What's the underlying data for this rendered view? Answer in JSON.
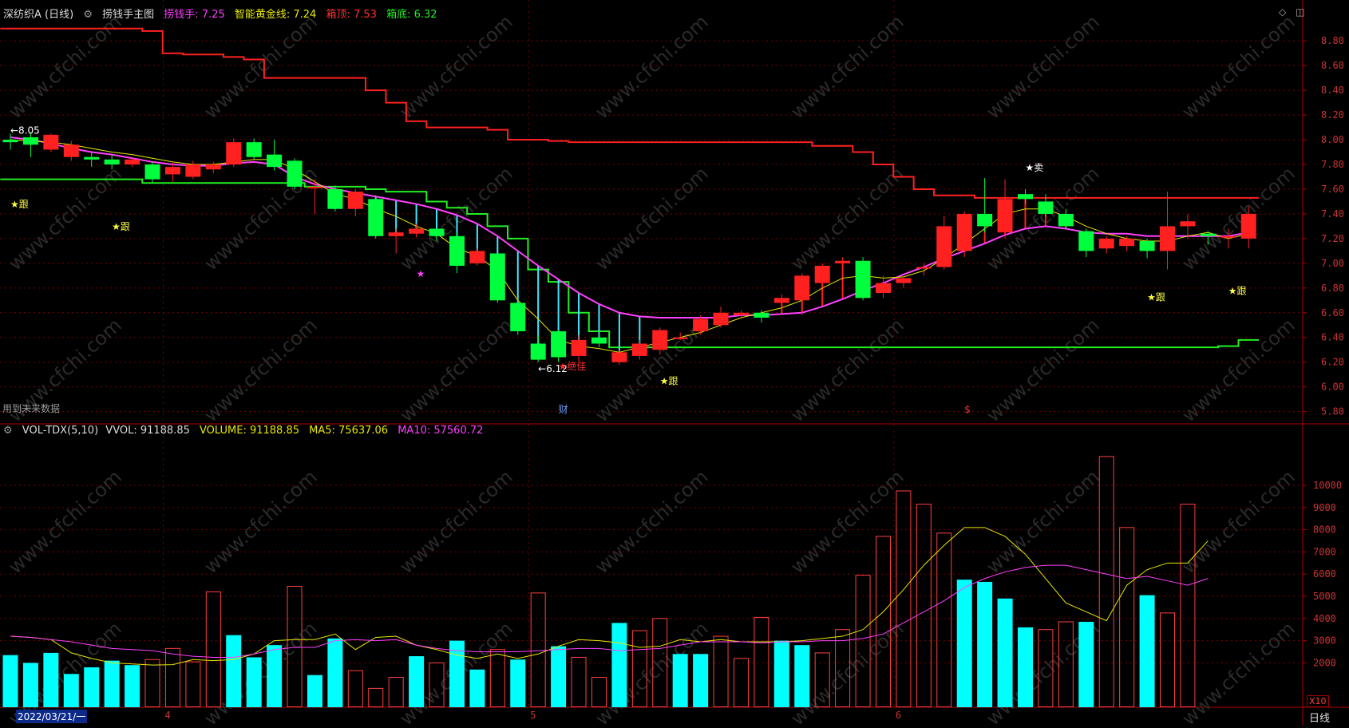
{
  "main_header": {
    "stock": "深纺织A (日线)",
    "indicator": "捞钱手主图",
    "lqs_label": "捞钱手: 7.25",
    "gold_label": "智能黄金线: 7.24",
    "top_label": "箱顶: 7.53",
    "bottom_label": "箱底: 6.32"
  },
  "vol_header": {
    "name": "VOL-TDX(5,10)",
    "vvol": "VVOL: 91188.85",
    "volume": "VOLUME: 91188.85",
    "ma5": "MA5: 75637.06",
    "ma10": "MA10: 57560.72"
  },
  "future_note": "用到未来数据",
  "date_label": "2022/03/21/一",
  "period_label": "日线",
  "vol_unit": "X10",
  "watermark": "www.cfchi.com",
  "colors": {
    "up": "#ff2020",
    "down": "#00ff3c",
    "vol_down": "#00ffff",
    "ma5": "#e8e800",
    "ma10": "#ff40ff",
    "box_top": "#ff2020",
    "box_bottom": "#22ee22",
    "grid": "#7a0000"
  },
  "chart_data": [
    {
      "type": "candlestick",
      "y_ticks": [
        "8.80",
        "8.60",
        "8.40",
        "8.20",
        "8.00",
        "7.80",
        "7.60",
        "7.40",
        "7.20",
        "7.00",
        "6.80",
        "6.60",
        "6.40",
        "6.20",
        "6.00",
        "5.80"
      ],
      "ylim": [
        5.72,
        8.95
      ],
      "month_markers": [
        "4",
        "5",
        "6"
      ],
      "candles": [
        [
          8.0,
          7.98,
          8.05,
          7.92
        ],
        [
          8.02,
          7.96,
          8.06,
          7.86
        ],
        [
          7.92,
          8.04,
          8.05,
          7.9
        ],
        [
          7.86,
          7.96,
          7.99,
          7.83
        ],
        [
          7.86,
          7.84,
          7.9,
          7.78
        ],
        [
          7.84,
          7.8,
          7.88,
          7.76
        ],
        [
          7.8,
          7.84,
          7.86,
          7.78
        ],
        [
          7.8,
          7.68,
          7.82,
          7.65
        ],
        [
          7.72,
          7.78,
          7.82,
          7.66
        ],
        [
          7.7,
          7.8,
          7.83,
          7.68
        ],
        [
          7.76,
          7.8,
          7.82,
          7.73
        ],
        [
          7.8,
          7.98,
          8.01,
          7.78
        ],
        [
          7.98,
          7.86,
          8.01,
          7.84
        ],
        [
          7.88,
          7.78,
          8.0,
          7.75
        ],
        [
          7.83,
          7.62,
          7.85,
          7.6
        ],
        [
          7.62,
          7.62,
          7.68,
          7.4
        ],
        [
          7.6,
          7.44,
          7.63,
          7.42
        ],
        [
          7.44,
          7.58,
          7.6,
          7.38
        ],
        [
          7.52,
          7.22,
          7.55,
          7.2
        ],
        [
          7.22,
          7.25,
          7.28,
          7.08
        ],
        [
          7.24,
          7.28,
          7.32,
          7.21
        ],
        [
          7.28,
          7.22,
          7.28,
          7.18
        ],
        [
          7.22,
          6.98,
          7.25,
          6.92
        ],
        [
          7.0,
          7.1,
          7.12,
          6.98
        ],
        [
          7.08,
          6.7,
          7.08,
          6.68
        ],
        [
          6.68,
          6.45,
          6.72,
          6.42
        ],
        [
          6.35,
          6.22,
          6.42,
          6.2
        ],
        [
          6.45,
          6.24,
          6.46,
          6.2
        ],
        [
          6.25,
          6.38,
          6.42,
          6.2
        ],
        [
          6.4,
          6.35,
          6.45,
          6.32
        ],
        [
          6.2,
          6.28,
          6.3,
          6.18
        ],
        [
          6.25,
          6.35,
          6.38,
          6.22
        ],
        [
          6.3,
          6.46,
          6.48,
          6.26
        ],
        [
          6.4,
          6.4,
          6.44,
          6.38
        ],
        [
          6.45,
          6.55,
          6.58,
          6.42
        ],
        [
          6.5,
          6.6,
          6.65,
          6.48
        ],
        [
          6.58,
          6.6,
          6.62,
          6.55
        ],
        [
          6.6,
          6.56,
          6.62,
          6.52
        ],
        [
          6.68,
          6.72,
          6.75,
          6.62
        ],
        [
          6.7,
          6.9,
          6.92,
          6.58
        ],
        [
          6.84,
          6.98,
          7.0,
          6.8
        ],
        [
          7.0,
          7.02,
          7.05,
          6.9
        ],
        [
          7.02,
          6.72,
          7.05,
          6.7
        ],
        [
          6.76,
          6.84,
          6.9,
          6.72
        ],
        [
          6.84,
          6.88,
          6.9,
          6.8
        ],
        [
          6.96,
          6.97,
          7.0,
          6.9
        ],
        [
          6.97,
          7.3,
          7.38,
          6.95
        ],
        [
          7.1,
          7.4,
          7.42,
          7.05
        ],
        [
          7.4,
          7.3,
          7.69,
          7.25
        ],
        [
          7.25,
          7.52,
          7.68,
          7.2
        ],
        [
          7.56,
          7.52,
          7.6,
          7.48
        ],
        [
          7.5,
          7.4,
          7.56,
          7.38
        ],
        [
          7.4,
          7.3,
          7.44,
          7.28
        ],
        [
          7.26,
          7.1,
          7.28,
          7.05
        ],
        [
          7.12,
          7.2,
          7.22,
          7.08
        ],
        [
          7.14,
          7.2,
          7.22,
          7.1
        ],
        [
          7.18,
          7.1,
          7.2,
          7.04
        ],
        [
          7.1,
          7.3,
          7.58,
          6.95
        ],
        [
          7.3,
          7.34,
          7.4,
          7.2
        ],
        [
          7.24,
          7.22,
          7.26,
          7.15
        ],
        [
          7.22,
          7.22,
          7.28,
          7.12
        ],
        [
          7.2,
          7.4,
          7.46,
          7.12
        ]
      ],
      "series": [
        {
          "name": "箱顶",
          "values": [
            8.9,
            8.9,
            8.9,
            8.9,
            8.9,
            8.9,
            8.9,
            8.88,
            8.7,
            8.69,
            8.69,
            8.67,
            8.65,
            8.5,
            8.5,
            8.5,
            8.5,
            8.5,
            8.4,
            8.3,
            8.15,
            8.1,
            8.1,
            8.1,
            8.08,
            8.0,
            8.0,
            7.99,
            7.98,
            7.98,
            7.98,
            7.98,
            7.98,
            7.98,
            7.98,
            7.98,
            7.98,
            7.98,
            7.98,
            7.98,
            7.95,
            7.95,
            7.9,
            7.8,
            7.7,
            7.6,
            7.55,
            7.55,
            7.53,
            7.53,
            7.53,
            7.53,
            7.53,
            7.53,
            7.53,
            7.53,
            7.53,
            7.53,
            7.53,
            7.53,
            7.53,
            7.53
          ]
        },
        {
          "name": "箱底",
          "values": [
            7.68,
            7.68,
            7.68,
            7.68,
            7.68,
            7.68,
            7.68,
            7.65,
            7.65,
            7.65,
            7.65,
            7.65,
            7.65,
            7.65,
            7.65,
            7.62,
            7.62,
            7.62,
            7.6,
            7.58,
            7.58,
            7.5,
            7.45,
            7.4,
            7.3,
            7.2,
            6.95,
            6.85,
            6.6,
            6.45,
            6.32,
            6.32,
            6.32,
            6.32,
            6.32,
            6.32,
            6.32,
            6.32,
            6.32,
            6.32,
            6.32,
            6.32,
            6.32,
            6.32,
            6.32,
            6.32,
            6.32,
            6.32,
            6.32,
            6.32,
            6.32,
            6.32,
            6.32,
            6.32,
            6.32,
            6.32,
            6.32,
            6.32,
            6.32,
            6.32,
            6.33,
            6.38
          ]
        },
        {
          "name": "捞钱手",
          "values": [
            8.02,
            8.0,
            7.97,
            7.93,
            7.9,
            7.88,
            7.85,
            7.82,
            7.8,
            7.79,
            7.79,
            7.81,
            7.82,
            7.8,
            7.7,
            7.64,
            7.6,
            7.57,
            7.54,
            7.51,
            7.48,
            7.44,
            7.39,
            7.32,
            7.22,
            7.1,
            6.98,
            6.87,
            6.76,
            6.67,
            6.6,
            6.57,
            6.56,
            6.56,
            6.56,
            6.56,
            6.58,
            6.58,
            6.59,
            6.6,
            6.65,
            6.71,
            6.78,
            6.84,
            6.91,
            6.97,
            7.04,
            7.1,
            7.16,
            7.23,
            7.28,
            7.3,
            7.28,
            7.25,
            7.24,
            7.24,
            7.22,
            7.22,
            7.22,
            7.22,
            7.22,
            7.25
          ]
        },
        {
          "name": "智能黄金线",
          "values": [
            8.0,
            7.99,
            7.98,
            7.96,
            7.93,
            7.9,
            7.88,
            7.85,
            7.82,
            7.8,
            7.8,
            7.82,
            7.84,
            7.84,
            7.76,
            7.66,
            7.56,
            7.52,
            7.44,
            7.38,
            7.3,
            7.24,
            7.12,
            7.06,
            6.94,
            6.7,
            6.55,
            6.38,
            6.33,
            6.31,
            6.28,
            6.32,
            6.36,
            6.4,
            6.44,
            6.5,
            6.56,
            6.6,
            6.64,
            6.7,
            6.8,
            6.88,
            6.9,
            6.88,
            6.89,
            6.94,
            7.04,
            7.16,
            7.28,
            7.4,
            7.44,
            7.44,
            7.38,
            7.3,
            7.24,
            7.2,
            7.18,
            7.18,
            7.22,
            7.25,
            7.2,
            7.24
          ]
        }
      ],
      "annotations": [
        {
          "text": "←8.05",
          "i": 0,
          "y": 8.05
        },
        {
          "text": "←6.12",
          "i": 26,
          "y": 6.12
        },
        {
          "text": "★跟",
          "i": 0,
          "y": 7.45
        },
        {
          "text": "★跟",
          "i": 5,
          "y": 7.27
        },
        {
          "text": "★",
          "i": 20,
          "y": 6.89
        },
        {
          "text": "★绝佳",
          "i": 27,
          "y": 6.14
        },
        {
          "text": "★跟",
          "i": 32,
          "y": 6.02
        },
        {
          "text": "★卖",
          "i": 50,
          "y": 7.75
        },
        {
          "text": "★跟",
          "i": 56,
          "y": 6.7
        },
        {
          "text": "★跟",
          "i": 60,
          "y": 6.75
        },
        {
          "text": "财",
          "i": 27,
          "y": 5.79
        },
        {
          "text": "$",
          "i": 47,
          "y": 5.79
        }
      ]
    },
    {
      "type": "bar",
      "title": "VOL-TDX(5,10)",
      "y_ticks": [
        "10000",
        "9000",
        "8000",
        "7000",
        "6000",
        "5000",
        "4000",
        "3000",
        "2000"
      ],
      "ylim": [
        0,
        11800
      ],
      "values": [
        2350,
        2000,
        2450,
        1500,
        1800,
        2100,
        1900,
        2150,
        2650,
        2050,
        5200,
        3250,
        2250,
        2800,
        5450,
        1450,
        3100,
        1650,
        850,
        1350,
        2300,
        2000,
        3000,
        1700,
        2600,
        2150,
        5150,
        2750,
        2250,
        1350,
        3800,
        3450,
        4000,
        2400,
        2400,
        3200,
        2200,
        4050,
        3000,
        2800,
        2450,
        3500,
        5950,
        7700,
        9750,
        9150,
        7850,
        5750,
        5650,
        4900,
        3600,
        3500,
        3850,
        3850,
        11300,
        8100,
        5050,
        4250,
        9150
      ],
      "down": [
        1,
        1,
        1,
        1,
        1,
        1,
        1,
        0,
        0,
        0,
        0,
        1,
        1,
        1,
        0,
        1,
        1,
        0,
        0,
        0,
        1,
        0,
        1,
        1,
        0,
        1,
        0,
        1,
        0,
        0,
        1,
        0,
        0,
        1,
        1,
        0,
        0,
        0,
        1,
        1,
        0,
        0,
        0,
        0,
        0,
        0,
        0,
        1,
        1,
        1,
        1,
        0,
        0,
        1,
        0,
        0,
        1,
        0,
        0
      ],
      "series": [
        {
          "name": "MA5",
          "values": [
            3200,
            3150,
            3050,
            2450,
            2200,
            2000,
            1950,
            1900,
            1920,
            2150,
            2100,
            2150,
            2400,
            3000,
            3050,
            3050,
            3300,
            2600,
            3150,
            3200,
            2800,
            2600,
            2350,
            2200,
            2400,
            2200,
            2400,
            2750,
            3050,
            3000,
            2900,
            2700,
            2750,
            3050,
            2950,
            3050,
            2950,
            2950,
            2950,
            3000,
            3100,
            3200,
            3500,
            4300,
            5300,
            6400,
            7300,
            8100,
            8100,
            7700,
            6900,
            5800,
            4700,
            4300,
            3900,
            5500,
            6200,
            6500,
            6500,
            7500
          ]
        },
        {
          "name": "MA10",
          "values": [
            3200,
            3150,
            3050,
            2950,
            2800,
            2650,
            2600,
            2550,
            2400,
            2300,
            2250,
            2250,
            2400,
            2600,
            2700,
            2700,
            3000,
            3050,
            3000,
            3050,
            2800,
            2650,
            2550,
            2500,
            2500,
            2500,
            2550,
            2600,
            2650,
            2650,
            2550,
            2600,
            2650,
            2800,
            2950,
            2950,
            2950,
            2900,
            2950,
            2950,
            3000,
            3000,
            3100,
            3300,
            3800,
            4300,
            4800,
            5400,
            5800,
            6100,
            6300,
            6400,
            6400,
            6200,
            6000,
            5800,
            5900,
            5700,
            5500,
            5800
          ]
        }
      ]
    }
  ]
}
